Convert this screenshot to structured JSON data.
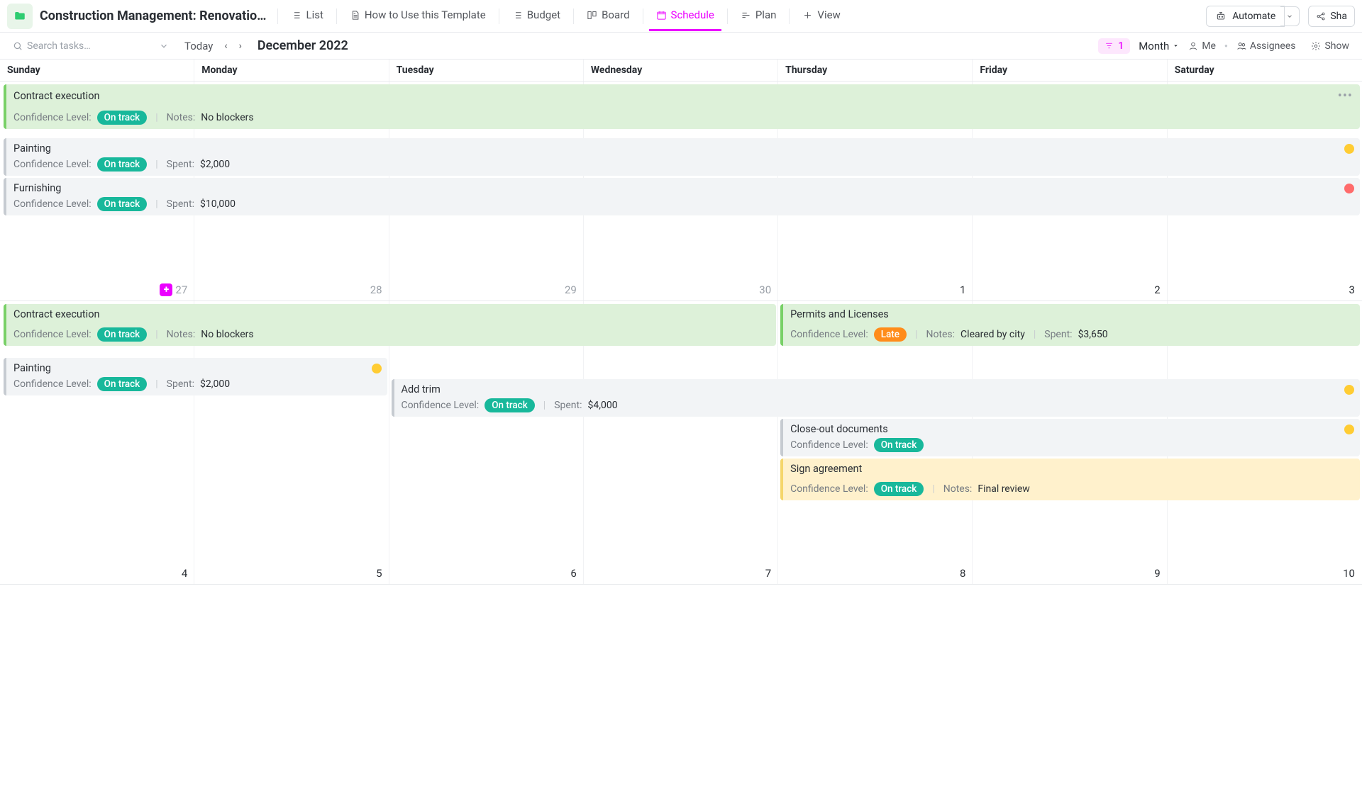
{
  "header": {
    "title": "Construction Management: Renovatio…",
    "tabs": [
      {
        "label": "List",
        "icon": "list"
      },
      {
        "label": "How to Use this Template",
        "icon": "doc"
      },
      {
        "label": "Budget",
        "icon": "list"
      },
      {
        "label": "Board",
        "icon": "board"
      },
      {
        "label": "Schedule",
        "icon": "calendar",
        "active": true
      },
      {
        "label": "Plan",
        "icon": "plan"
      },
      {
        "label": "View",
        "icon": "plus"
      }
    ],
    "automate": "Automate",
    "share": "Sha"
  },
  "subheader": {
    "search_placeholder": "Search tasks…",
    "today": "Today",
    "month_label": "December 2022",
    "filter_count": "1",
    "view_dropdown": "Month",
    "me": "Me",
    "assignees": "Assignees",
    "show": "Show"
  },
  "days": [
    "Sunday",
    "Monday",
    "Tuesday",
    "Wednesday",
    "Thursday",
    "Friday",
    "Saturday"
  ],
  "week1_dates": [
    "27",
    "28",
    "29",
    "30",
    "1",
    "2",
    "3"
  ],
  "week2_dates": [
    "4",
    "5",
    "6",
    "7",
    "8",
    "9",
    "10"
  ],
  "labels": {
    "conf": "Confidence Level:",
    "spent": "Spent:",
    "notes": "Notes:"
  },
  "badges": {
    "ontrack": "On track",
    "late": "Late"
  },
  "events": {
    "contract": {
      "title": "Contract execution",
      "notes": "No blockers"
    },
    "painting": {
      "title": "Painting",
      "spent": "$2,000"
    },
    "furnishing": {
      "title": "Furnishing",
      "spent": "$10,000"
    },
    "permits": {
      "title": "Permits and Licenses",
      "notes": "Cleared by city",
      "spent": "$3,650"
    },
    "addtrim": {
      "title": "Add trim",
      "spent": "$4,000"
    },
    "closeout": {
      "title": "Close-out documents"
    },
    "sign": {
      "title": "Sign agreement",
      "notes": "Final review"
    }
  }
}
